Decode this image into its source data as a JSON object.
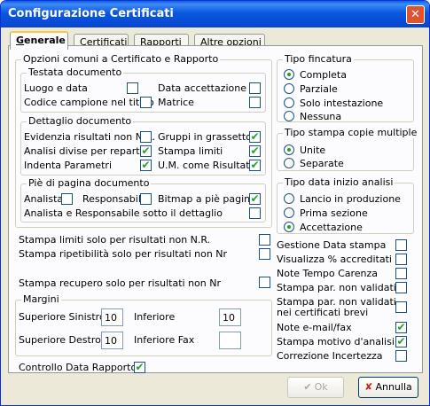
{
  "window": {
    "title": "Configurazione Certificati",
    "close_glyph": "✕"
  },
  "tabs": [
    "Generale",
    "Certificati",
    "Rapporti",
    "Altre opzioni"
  ],
  "tab_underlined": [
    "G",
    "C",
    "R",
    "A"
  ],
  "tab_rest": [
    "enerale",
    "ertificati",
    "apporti",
    "ltre opzioni"
  ],
  "opzioni_comuni": {
    "title": "Opzioni comuni a Certificato e Rapporto",
    "testata": {
      "title": "Testata documento",
      "items": [
        {
          "label": "Luogo e data",
          "checked": false
        },
        {
          "label": "Data accettazione",
          "checked": false
        },
        {
          "label": "Codice campione nel titolo",
          "checked": false
        },
        {
          "label": "Matrice",
          "checked": false
        }
      ]
    },
    "dettaglio": {
      "title": "Dettaglio documento",
      "items": [
        {
          "label": "Evidenzia risultati non N.R.",
          "checked": false
        },
        {
          "label": "Gruppi in grassetto",
          "checked": true
        },
        {
          "label": "Analisi divise per reparto",
          "checked": true
        },
        {
          "label": "Stampa limiti",
          "checked": true
        },
        {
          "label": "Indenta Parametri",
          "checked": true
        },
        {
          "label": "U.M. come Risultato",
          "checked": true
        }
      ]
    },
    "piede": {
      "title": "Piè di pagina documento",
      "items": [
        {
          "label": "Analista",
          "checked": false
        },
        {
          "label": "Responsabile",
          "checked": false
        },
        {
          "label": "Bitmap a piè pagina",
          "checked": true
        },
        {
          "label": "Analista e Responsabile sotto il dettaglio",
          "checked": false
        }
      ]
    }
  },
  "standalone": [
    {
      "label": "Stampa limiti solo per risultati non N.R.",
      "checked": false
    },
    {
      "label": "Stampa ripetibilità solo per risultati non Nr",
      "checked": false
    },
    {
      "label": "Stampa recupero solo per risultati non Nr",
      "checked": false
    }
  ],
  "margini": {
    "title": "Margini",
    "sup_sin": {
      "label": "Superiore Sinistro",
      "value": "10"
    },
    "inferiore": {
      "label": "Inferiore",
      "value": "10"
    },
    "sup_des": {
      "label": "Superiore Destro",
      "value": "10"
    },
    "inf_fax": {
      "label": "Inferiore Fax",
      "value": ""
    }
  },
  "controllo": {
    "label": "Controllo Data Rapporto",
    "checked": true
  },
  "tipo_fincatura": {
    "title": "Tipo fincatura",
    "options": [
      "Completa",
      "Parziale",
      "Solo intestazione",
      "Nessuna"
    ],
    "selected": 0
  },
  "tipo_stampa": {
    "title": "Tipo stampa copie multiple",
    "options": [
      "Unite",
      "Separate"
    ],
    "selected": 0
  },
  "tipo_data": {
    "title": "Tipo data inizio analisi",
    "options": [
      "Lancio in produzione",
      "Prima sezione",
      "Accettazione"
    ],
    "selected": 2
  },
  "right_checks": [
    {
      "label": "Gestione Data stampa",
      "checked": false
    },
    {
      "label": "Visualizza % accreditati",
      "checked": false
    },
    {
      "label": "Note Tempo Carenza",
      "checked": false
    },
    {
      "label": "Stampa par. non validati",
      "checked": false
    },
    {
      "label": "Stampa par. non validati",
      "label2": "nei certificati brevi",
      "checked": false
    },
    {
      "label": "Note e-mail/fax",
      "checked": true
    },
    {
      "label": "Stampa motivo d'analisi",
      "checked": true
    },
    {
      "label": "Correzione Incertezza",
      "checked": false
    }
  ],
  "buttons": {
    "ok": "Ok",
    "annulla": "Annulla",
    "ok_icon": "✔",
    "annulla_icon": "✘"
  },
  "colors": {
    "titlebar": "#0A58E0",
    "face": "#ECE9D8",
    "check": "#21A121",
    "close": "#E0532F"
  }
}
